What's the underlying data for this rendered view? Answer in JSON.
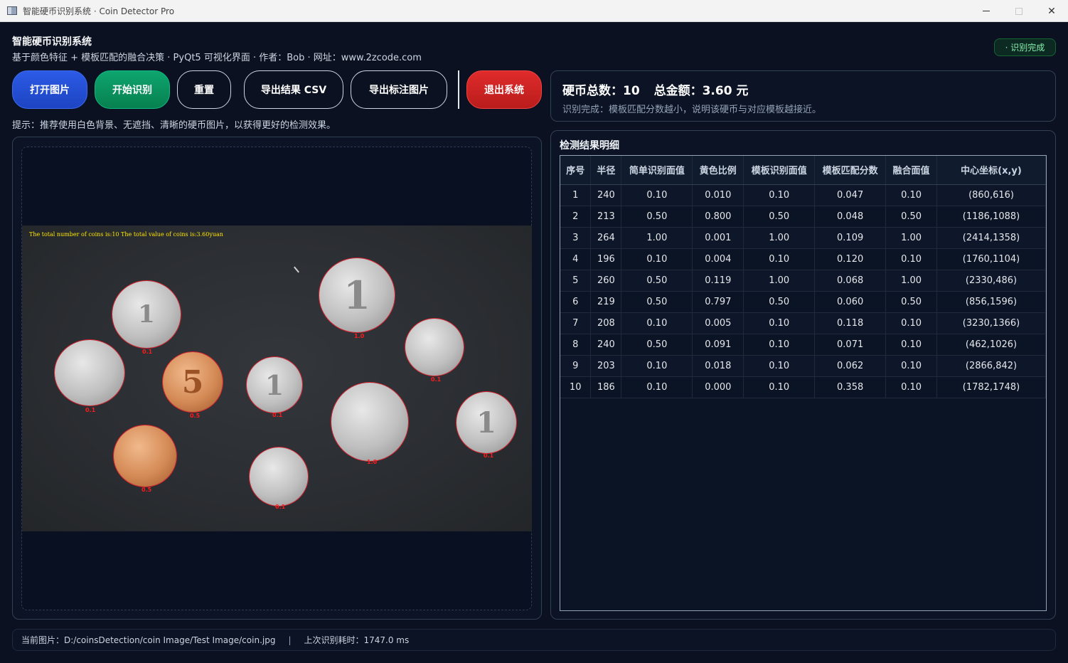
{
  "window": {
    "title": "智能硬币识别系统 · Coin Detector Pro"
  },
  "header": {
    "title": "智能硬币识别系统",
    "subtitle": "基于颜色特征 + 模板匹配的融合决策 · PyQt5 可视化界面 · 作者：Bob · 网址：www.2zcode.com",
    "status_badge": "· 识别完成"
  },
  "toolbar": {
    "open_label": "打开图片",
    "start_label": "开始识别",
    "reset_label": "重置",
    "export_csv_label": "导出结果 CSV",
    "export_img_label": "导出标注图片",
    "exit_label": "退出系统"
  },
  "hint": "提示：推荐使用白色背景、无遮挡、清晰的硬币图片，以获得更好的检测效果。",
  "image": {
    "caption": "The total number of coins is:10 The total value of coins is:3.60yuan",
    "coin_labels": [
      "0.1",
      "0.1",
      "0.5",
      "0.1",
      "1.0",
      "0.1",
      "1.0",
      "0.1",
      "0.5",
      "0.1"
    ],
    "coin_faces": [
      "1",
      "",
      "5",
      "1",
      "1",
      "",
      "",
      "1",
      "",
      ""
    ]
  },
  "summary": {
    "count_text": "硬币总数：10",
    "amount_text": "总金额：3.60 元",
    "note": "识别完成：模板匹配分数越小，说明该硬币与对应模板越接近。"
  },
  "table": {
    "title": "检测结果明细",
    "columns": [
      "序号",
      "半径",
      "简单识别面值",
      "黄色比例",
      "模板识别面值",
      "模板匹配分数",
      "融合面值",
      "中心坐标(x,y)"
    ],
    "rows": [
      [
        "1",
        "240",
        "0.10",
        "0.010",
        "0.10",
        "0.047",
        "0.10",
        "(860,616)"
      ],
      [
        "2",
        "213",
        "0.50",
        "0.800",
        "0.50",
        "0.048",
        "0.50",
        "(1186,1088)"
      ],
      [
        "3",
        "264",
        "1.00",
        "0.001",
        "1.00",
        "0.109",
        "1.00",
        "(2414,1358)"
      ],
      [
        "4",
        "196",
        "0.10",
        "0.004",
        "0.10",
        "0.120",
        "0.10",
        "(1760,1104)"
      ],
      [
        "5",
        "260",
        "0.50",
        "0.119",
        "1.00",
        "0.068",
        "1.00",
        "(2330,486)"
      ],
      [
        "6",
        "219",
        "0.50",
        "0.797",
        "0.50",
        "0.060",
        "0.50",
        "(856,1596)"
      ],
      [
        "7",
        "208",
        "0.10",
        "0.005",
        "0.10",
        "0.118",
        "0.10",
        "(3230,1366)"
      ],
      [
        "8",
        "240",
        "0.50",
        "0.091",
        "0.10",
        "0.071",
        "0.10",
        "(462,1026)"
      ],
      [
        "9",
        "203",
        "0.10",
        "0.018",
        "0.10",
        "0.062",
        "0.10",
        "(2866,842)"
      ],
      [
        "10",
        "186",
        "0.10",
        "0.000",
        "0.10",
        "0.358",
        "0.10",
        "(1782,1748)"
      ]
    ]
  },
  "footer": {
    "current_image": "当前图片：D:/coinsDetection/coin Image/Test Image/coin.jpg",
    "separator": "|",
    "elapsed": "上次识别耗时：1747.0 ms"
  },
  "colors": {
    "background": "#0b1120",
    "open_button": "#2c5be6",
    "start_button": "#0ea56f",
    "exit_button": "#e02b2b",
    "status_green": "#86efac",
    "coin_outline": "#e11d2a",
    "caption_yellow": "#ffe600"
  },
  "icons": [
    "app-window-icon",
    "minimize-icon",
    "maximize-icon",
    "close-icon"
  ]
}
